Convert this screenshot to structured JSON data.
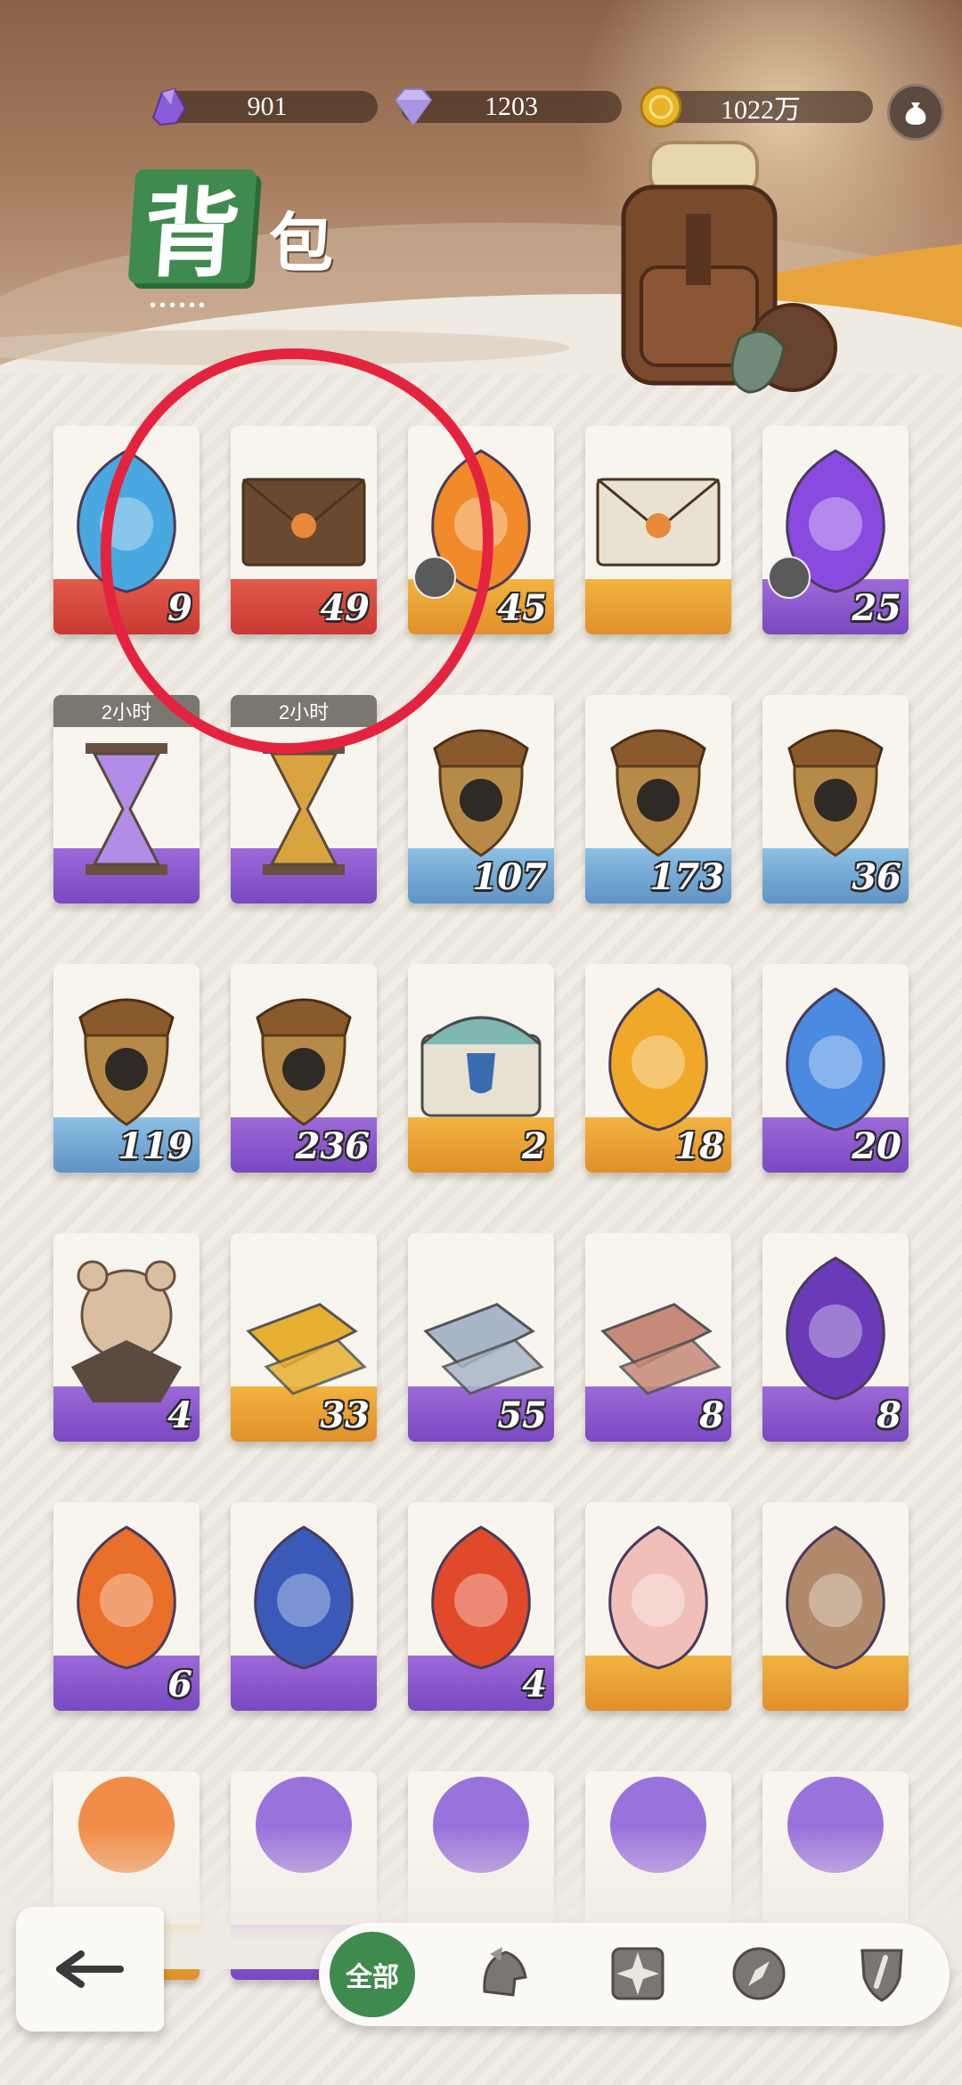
{
  "currencies": [
    {
      "name": "purple-crystal",
      "value": "901"
    },
    {
      "name": "diamond",
      "value": "1203"
    },
    {
      "name": "gold-coin",
      "value": "1022万"
    }
  ],
  "title": {
    "main": "背",
    "second": "包",
    "dots": "••••••"
  },
  "items": [
    {
      "count": "9",
      "theme": "red",
      "art": "mask"
    },
    {
      "count": "49",
      "theme": "red",
      "art": "envelope-dark"
    },
    {
      "count": "45",
      "theme": "orange",
      "art": "fire-trident",
      "puzzle": true
    },
    {
      "count": "",
      "theme": "orange",
      "art": "envelope-light"
    },
    {
      "count": "25",
      "theme": "purple",
      "art": "purple-trident",
      "puzzle": true
    },
    {
      "count": "",
      "theme": "purple",
      "art": "hourglass-purple",
      "timer": "2小时"
    },
    {
      "count": "",
      "theme": "purple",
      "art": "hourglass-gold",
      "timer": "2小时"
    },
    {
      "count": "107",
      "theme": "blue",
      "art": "acorn-eye"
    },
    {
      "count": "173",
      "theme": "blue",
      "art": "acorn-pin"
    },
    {
      "count": "36",
      "theme": "blue",
      "art": "acorn-leaf"
    },
    {
      "count": "119",
      "theme": "blue",
      "art": "acorn-star"
    },
    {
      "count": "236",
      "theme": "purple",
      "art": "acorn-diamond"
    },
    {
      "count": "2",
      "theme": "orange",
      "art": "chest"
    },
    {
      "count": "18",
      "theme": "orange",
      "art": "gold-key-gem"
    },
    {
      "count": "20",
      "theme": "purple",
      "art": "blue-key-gem"
    },
    {
      "count": "4",
      "theme": "purple",
      "art": "hamster"
    },
    {
      "count": "33",
      "theme": "orange",
      "art": "gold-ingot"
    },
    {
      "count": "55",
      "theme": "purple",
      "art": "silver-ingot"
    },
    {
      "count": "8",
      "theme": "purple",
      "art": "copper-ingot"
    },
    {
      "count": "8",
      "theme": "purple",
      "art": "purple-sigil"
    },
    {
      "count": "6",
      "theme": "purple",
      "art": "fire-crystal"
    },
    {
      "count": "",
      "theme": "purple",
      "art": "wave-crystal"
    },
    {
      "count": "4",
      "theme": "purple",
      "art": "flame-crystal"
    },
    {
      "count": "",
      "theme": "orange",
      "art": "portrait-girl"
    },
    {
      "count": "",
      "theme": "orange",
      "art": "portrait-beast"
    },
    {
      "count": "",
      "theme": "orange",
      "art": "partial-fire"
    },
    {
      "count": "",
      "theme": "purple",
      "art": "partial-purple"
    },
    {
      "count": "",
      "theme": "purple",
      "art": "partial-purple"
    },
    {
      "count": "",
      "theme": "purple",
      "art": "partial-purple"
    },
    {
      "count": "",
      "theme": "purple",
      "art": "partial-purple"
    }
  ],
  "filters": {
    "all_label": "全部",
    "icons": [
      "helmet-icon",
      "compass-star-icon",
      "compass-icon",
      "shield-sword-icon"
    ]
  },
  "colors": {
    "accent_green": "#3f8a4e",
    "annotation_red": "#e4243e"
  }
}
